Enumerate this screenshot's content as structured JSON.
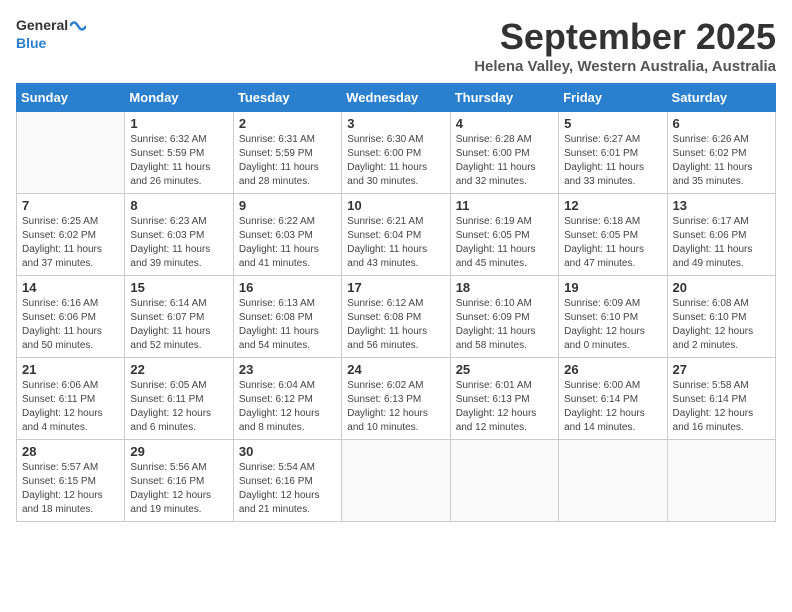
{
  "logo": {
    "line1": "General",
    "line2": "Blue"
  },
  "title": "September 2025",
  "subtitle": "Helena Valley, Western Australia, Australia",
  "days_of_week": [
    "Sunday",
    "Monday",
    "Tuesday",
    "Wednesday",
    "Thursday",
    "Friday",
    "Saturday"
  ],
  "weeks": [
    [
      {
        "day": "",
        "info": ""
      },
      {
        "day": "1",
        "info": "Sunrise: 6:32 AM\nSunset: 5:59 PM\nDaylight: 11 hours\nand 26 minutes."
      },
      {
        "day": "2",
        "info": "Sunrise: 6:31 AM\nSunset: 5:59 PM\nDaylight: 11 hours\nand 28 minutes."
      },
      {
        "day": "3",
        "info": "Sunrise: 6:30 AM\nSunset: 6:00 PM\nDaylight: 11 hours\nand 30 minutes."
      },
      {
        "day": "4",
        "info": "Sunrise: 6:28 AM\nSunset: 6:00 PM\nDaylight: 11 hours\nand 32 minutes."
      },
      {
        "day": "5",
        "info": "Sunrise: 6:27 AM\nSunset: 6:01 PM\nDaylight: 11 hours\nand 33 minutes."
      },
      {
        "day": "6",
        "info": "Sunrise: 6:26 AM\nSunset: 6:02 PM\nDaylight: 11 hours\nand 35 minutes."
      }
    ],
    [
      {
        "day": "7",
        "info": "Sunrise: 6:25 AM\nSunset: 6:02 PM\nDaylight: 11 hours\nand 37 minutes."
      },
      {
        "day": "8",
        "info": "Sunrise: 6:23 AM\nSunset: 6:03 PM\nDaylight: 11 hours\nand 39 minutes."
      },
      {
        "day": "9",
        "info": "Sunrise: 6:22 AM\nSunset: 6:03 PM\nDaylight: 11 hours\nand 41 minutes."
      },
      {
        "day": "10",
        "info": "Sunrise: 6:21 AM\nSunset: 6:04 PM\nDaylight: 11 hours\nand 43 minutes."
      },
      {
        "day": "11",
        "info": "Sunrise: 6:19 AM\nSunset: 6:05 PM\nDaylight: 11 hours\nand 45 minutes."
      },
      {
        "day": "12",
        "info": "Sunrise: 6:18 AM\nSunset: 6:05 PM\nDaylight: 11 hours\nand 47 minutes."
      },
      {
        "day": "13",
        "info": "Sunrise: 6:17 AM\nSunset: 6:06 PM\nDaylight: 11 hours\nand 49 minutes."
      }
    ],
    [
      {
        "day": "14",
        "info": "Sunrise: 6:16 AM\nSunset: 6:06 PM\nDaylight: 11 hours\nand 50 minutes."
      },
      {
        "day": "15",
        "info": "Sunrise: 6:14 AM\nSunset: 6:07 PM\nDaylight: 11 hours\nand 52 minutes."
      },
      {
        "day": "16",
        "info": "Sunrise: 6:13 AM\nSunset: 6:08 PM\nDaylight: 11 hours\nand 54 minutes."
      },
      {
        "day": "17",
        "info": "Sunrise: 6:12 AM\nSunset: 6:08 PM\nDaylight: 11 hours\nand 56 minutes."
      },
      {
        "day": "18",
        "info": "Sunrise: 6:10 AM\nSunset: 6:09 PM\nDaylight: 11 hours\nand 58 minutes."
      },
      {
        "day": "19",
        "info": "Sunrise: 6:09 AM\nSunset: 6:10 PM\nDaylight: 12 hours\nand 0 minutes."
      },
      {
        "day": "20",
        "info": "Sunrise: 6:08 AM\nSunset: 6:10 PM\nDaylight: 12 hours\nand 2 minutes."
      }
    ],
    [
      {
        "day": "21",
        "info": "Sunrise: 6:06 AM\nSunset: 6:11 PM\nDaylight: 12 hours\nand 4 minutes."
      },
      {
        "day": "22",
        "info": "Sunrise: 6:05 AM\nSunset: 6:11 PM\nDaylight: 12 hours\nand 6 minutes."
      },
      {
        "day": "23",
        "info": "Sunrise: 6:04 AM\nSunset: 6:12 PM\nDaylight: 12 hours\nand 8 minutes."
      },
      {
        "day": "24",
        "info": "Sunrise: 6:02 AM\nSunset: 6:13 PM\nDaylight: 12 hours\nand 10 minutes."
      },
      {
        "day": "25",
        "info": "Sunrise: 6:01 AM\nSunset: 6:13 PM\nDaylight: 12 hours\nand 12 minutes."
      },
      {
        "day": "26",
        "info": "Sunrise: 6:00 AM\nSunset: 6:14 PM\nDaylight: 12 hours\nand 14 minutes."
      },
      {
        "day": "27",
        "info": "Sunrise: 5:58 AM\nSunset: 6:14 PM\nDaylight: 12 hours\nand 16 minutes."
      }
    ],
    [
      {
        "day": "28",
        "info": "Sunrise: 5:57 AM\nSunset: 6:15 PM\nDaylight: 12 hours\nand 18 minutes."
      },
      {
        "day": "29",
        "info": "Sunrise: 5:56 AM\nSunset: 6:16 PM\nDaylight: 12 hours\nand 19 minutes."
      },
      {
        "day": "30",
        "info": "Sunrise: 5:54 AM\nSunset: 6:16 PM\nDaylight: 12 hours\nand 21 minutes."
      },
      {
        "day": "",
        "info": ""
      },
      {
        "day": "",
        "info": ""
      },
      {
        "day": "",
        "info": ""
      },
      {
        "day": "",
        "info": ""
      }
    ]
  ]
}
